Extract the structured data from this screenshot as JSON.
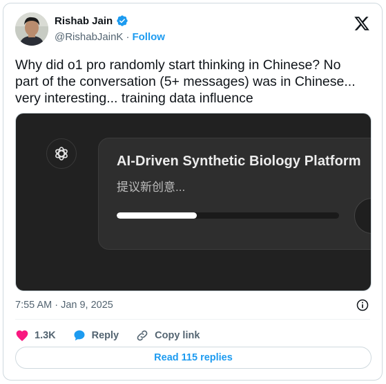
{
  "author": {
    "name": "Rishab Jain",
    "handle": "@RishabJainK",
    "separator": "·",
    "follow_label": "Follow"
  },
  "tweet": {
    "text": "Why did o1 pro randomly start thinking in Chinese? No\npart of the conversation (5+ messages) was in Chinese...\nvery interesting... training data influence",
    "timestamp": "7:55 AM · Jan 9, 2025"
  },
  "media": {
    "title": "AI-Driven Synthetic Biology Platform",
    "subtitle": "提议新创意...",
    "progress_fraction": 0.36
  },
  "actions": {
    "likes": "1.3K",
    "reply_label": "Reply",
    "copy_link_label": "Copy link"
  },
  "read_replies_label": "Read 115 replies",
  "colors": {
    "accent": "#1d9bf0",
    "like": "#f91880",
    "media_bg": "#212121"
  }
}
